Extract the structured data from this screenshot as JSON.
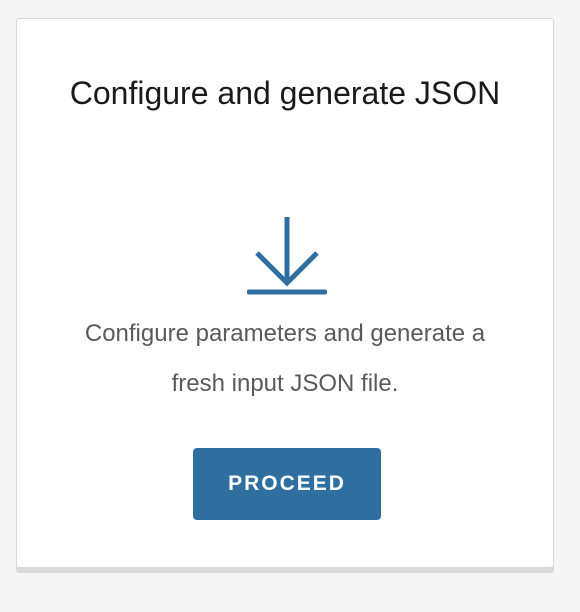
{
  "card": {
    "title": "Configure and generate JSON",
    "icon": "download-icon",
    "description": "Configure parameters and generate a fresh input JSON file.",
    "button_label": "PROCEED"
  },
  "colors": {
    "accent": "#2e6f9f",
    "icon": "#2e6f9f",
    "title_text": "#1a1a1a",
    "body_text": "#5a5a5a",
    "background": "#f5f5f5"
  }
}
